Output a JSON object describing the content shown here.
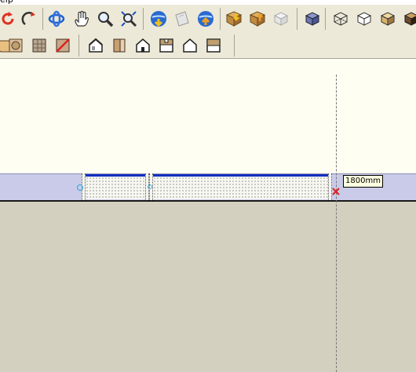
{
  "menubar": {
    "help_label": "elp"
  },
  "toolbar_row1": [
    {
      "name": "undo-icon"
    },
    {
      "name": "redo-icon"
    },
    {
      "name": "orbit-icon"
    },
    {
      "name": "pan-hand-icon"
    },
    {
      "name": "zoom-icon"
    },
    {
      "name": "zoom-extents-icon"
    },
    {
      "name": "get-models-icon"
    },
    {
      "name": "share-model-icon"
    },
    {
      "name": "upload-component-icon"
    },
    {
      "name": "get-photo-texture-icon"
    },
    {
      "name": "share-component-icon"
    },
    {
      "name": "component-icon"
    },
    {
      "name": "iso-view-icon"
    },
    {
      "name": "wireframe-style-icon"
    },
    {
      "name": "hidden-line-style-icon"
    },
    {
      "name": "shaded-style-icon"
    },
    {
      "name": "textured-style-icon"
    }
  ],
  "toolbar_row2": [
    {
      "name": "section-plane-icon"
    },
    {
      "name": "section-fill-icon"
    },
    {
      "name": "xray-icon"
    },
    {
      "name": "back-edges-icon"
    },
    {
      "name": "iso-view-button-icon"
    },
    {
      "name": "top-view-icon"
    },
    {
      "name": "front-view-icon"
    },
    {
      "name": "right-view-icon"
    },
    {
      "name": "back-view-icon"
    },
    {
      "name": "left-view-icon"
    }
  ],
  "viewport": {
    "dimension_tooltip": "1800mm",
    "colors": {
      "sky": "#fffef3",
      "ground": "#d4d0c0",
      "band": "#c9cbe8",
      "edge_blue": "#1030c0"
    }
  }
}
